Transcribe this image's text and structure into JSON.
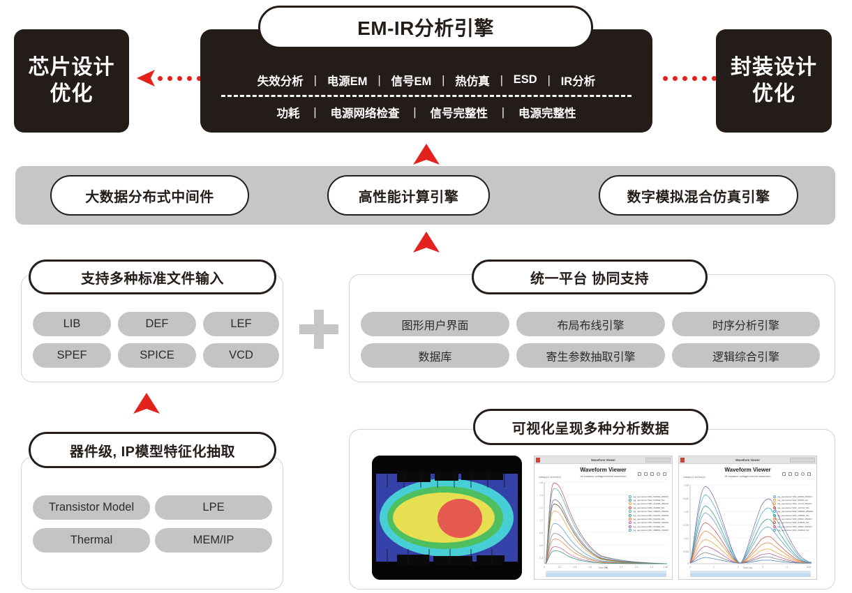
{
  "meta": {
    "colors": {
      "dark": "#231c18",
      "red": "#e3221d",
      "band_gray": "#c6c6c6",
      "tag_gray": "#c4c4c4",
      "card_border": "#d3d3d3",
      "white": "#ffffff"
    }
  },
  "left_outcome": {
    "line1": "芯片设计",
    "line2": "优化"
  },
  "right_outcome": {
    "line1": "封装设计",
    "line2": "优化"
  },
  "engine": {
    "title": "EM-IR分析引擎",
    "row1": [
      "失效分析",
      "电源EM",
      "信号EM",
      "热仿真",
      "ESD",
      "IR分析"
    ],
    "row2": [
      "功耗",
      "电源网络检查",
      "信号完整性",
      "电源完整性"
    ],
    "separator": "|"
  },
  "middleware_band": {
    "items": [
      {
        "label": "大数据分布式中间件"
      },
      {
        "label": "高性能计算引擎"
      },
      {
        "label": "数字模拟混合仿真引擎"
      }
    ]
  },
  "file_input_card": {
    "title": "支持多种标准文件输入",
    "tags": [
      "LIB",
      "DEF",
      "LEF",
      "SPEF",
      "SPICE",
      "VCD"
    ]
  },
  "platform_card": {
    "title": "统一平台 协同支持",
    "tags": [
      "图形用户界面",
      "布局布线引擎",
      "时序分析引擎",
      "数据库",
      "寄生参数抽取引擎",
      "逻辑综合引擎"
    ]
  },
  "model_card": {
    "title": "器件级, IP模型特征化抽取",
    "tags": [
      "Transistor Model",
      "LPE",
      "Thermal",
      "MEM/IP"
    ]
  },
  "visualization_card": {
    "title": "可视化呈现多种分析数据",
    "thermal_thumbnail": {
      "name": "thermal-map-thumbnail",
      "legend_order": [
        "blue",
        "cyan",
        "green",
        "yellow",
        "red"
      ]
    },
    "waveform_viewers": [
      {
        "window_title": "Waveform Viewer",
        "heading": "Waveform Viewer",
        "subheading": "all instance voltage/current waveform",
        "y_axis_label": "voltage(v) /current(A)",
        "x_axis_label": "Time (ns)",
        "y_ticks": [
          "1.6",
          "1.4",
          "1.2",
          "1.0",
          "0.8",
          "0.6",
          "0.4",
          "0.2",
          "0"
        ],
        "x_ticks": [
          "0",
          "0.2",
          "0.4",
          "0.6",
          "0.8",
          "1.0",
          "1.2",
          "1.4",
          "1.60"
        ],
        "legend": [
          "log_reports/csv:VDD_518590_250210",
          "log_reports/csv:VDD_518590_N/1",
          "log_reports/csv:VDD_312590_250210",
          "log_reports/csv:VDD_312590_N/1",
          "log_reports/csv:VDD_308020_250210",
          "log_reports/csv:VDD_521230_250210",
          "log_reports/csv:VDD_501230_N/1",
          "log_reports/csv:VDD_518090_250210",
          "log_reports/csv:VDD_519400_N/1",
          "log_reports/csv:VDD_369800_250210"
        ]
      },
      {
        "window_title": "Waveform Viewer",
        "heading": "Waveform Viewer",
        "subheading": "IR instance voltage/current waveform",
        "y_axis_label": "voltage(v) /current(A)",
        "x_axis_label": "Time (ns)",
        "y_ticks": [
          "0.05",
          "0.025",
          "0.02",
          "0.015",
          "0.01",
          "0.005",
          "0"
        ],
        "x_ticks": [
          "0",
          "1",
          "2",
          "3",
          "4",
          "5.00"
        ],
        "legend": [
          "log_reports/csv:VDD_60530_250210",
          "log_reports/csv:VDD_66590_N/1",
          "log_reports/csv:VDD_10710_250210",
          "log_reports/csv:VDD_101710_N/1",
          "log_reports/csv:VDD_258020_250210",
          "log_reports/csv:VDD_238550_N/1",
          "log_reports/csv:VDD_23602_250210",
          "log_reports/csv:VDD_278020_N/1",
          "log_reports/csv:VDD_32802_250210",
          "log_reports/csv:VDD_219015_N/1"
        ]
      }
    ]
  },
  "plus_separator": {
    "symbol": "+"
  },
  "arrows": {
    "to_left_outcome": "arrow-left-dotted",
    "to_right_outcome": "arrow-right-dotted",
    "band_to_engine": "arrow-up",
    "cards_to_band": "arrow-up",
    "model_to_file_input": "arrow-up"
  },
  "chart_data": [
    {
      "type": "line",
      "title": "Waveform Viewer",
      "subtitle": "all instance voltage/current waveform",
      "xlabel": "Time (ns)",
      "ylabel": "voltage(v) /current(A)",
      "xlim": [
        0,
        1.6
      ],
      "ylim": [
        0,
        1.6
      ],
      "grid": true,
      "legend_position": "right",
      "x": [
        0,
        0.05,
        0.1,
        0.15,
        0.2,
        0.25,
        0.3,
        0.4,
        0.5,
        0.6,
        0.8,
        1.0,
        1.2,
        1.4,
        1.6
      ],
      "series": [
        {
          "name": "VDD_518590_250210",
          "color": "#c0504d",
          "values": [
            0,
            0.7,
            1.35,
            1.5,
            1.5,
            1.45,
            1.3,
            1.0,
            0.72,
            0.5,
            0.25,
            0.13,
            0.07,
            0.04,
            0.02
          ]
        },
        {
          "name": "VDD_518590_N/1",
          "color": "#4bacc6",
          "values": [
            0,
            0.62,
            1.22,
            1.38,
            1.4,
            1.34,
            1.2,
            0.92,
            0.66,
            0.46,
            0.23,
            0.12,
            0.06,
            0.035,
            0.02
          ]
        },
        {
          "name": "VDD_312590_250210",
          "color": "#8064a2",
          "values": [
            0,
            0.52,
            1.0,
            1.13,
            1.15,
            1.1,
            1.0,
            0.76,
            0.55,
            0.38,
            0.19,
            0.1,
            0.05,
            0.03,
            0.015
          ]
        },
        {
          "name": "VDD_312590_N/1",
          "color": "#4f6228",
          "values": [
            0,
            0.48,
            0.93,
            1.06,
            1.08,
            1.03,
            0.94,
            0.71,
            0.51,
            0.36,
            0.18,
            0.09,
            0.05,
            0.03,
            0.015
          ]
        },
        {
          "name": "VDD_308020_250210",
          "color": "#e8a33d",
          "values": [
            0,
            0.42,
            0.82,
            0.93,
            0.95,
            0.91,
            0.83,
            0.63,
            0.45,
            0.31,
            0.16,
            0.08,
            0.04,
            0.025,
            0.012
          ]
        },
        {
          "name": "VDD_521230_250210",
          "color": "#5b9bd5",
          "values": [
            0,
            0.33,
            0.64,
            0.73,
            0.74,
            0.71,
            0.65,
            0.49,
            0.35,
            0.25,
            0.12,
            0.06,
            0.03,
            0.02,
            0.01
          ]
        },
        {
          "name": "VDD_501230_N/1",
          "color": "#7f7f7f",
          "values": [
            0,
            0.23,
            0.45,
            0.51,
            0.52,
            0.5,
            0.45,
            0.34,
            0.25,
            0.17,
            0.09,
            0.045,
            0.025,
            0.015,
            0.008
          ]
        },
        {
          "name": "VDD_518090_250210",
          "color": "#ed7d31",
          "values": [
            0,
            0.19,
            0.37,
            0.42,
            0.43,
            0.41,
            0.37,
            0.28,
            0.2,
            0.14,
            0.07,
            0.035,
            0.02,
            0.012,
            0.006
          ]
        },
        {
          "name": "VDD_519400_N/1",
          "color": "#c55a9a",
          "values": [
            0,
            0.13,
            0.26,
            0.3,
            0.31,
            0.29,
            0.27,
            0.2,
            0.15,
            0.1,
            0.05,
            0.025,
            0.014,
            0.009,
            0.004
          ]
        },
        {
          "name": "VDD_369800_250210",
          "color": "#2e9e7e",
          "values": [
            0,
            0.1,
            0.2,
            0.23,
            0.24,
            0.23,
            0.21,
            0.16,
            0.11,
            0.08,
            0.04,
            0.02,
            0.011,
            0.007,
            0.003
          ]
        }
      ]
    },
    {
      "type": "line",
      "title": "Waveform Viewer",
      "subtitle": "IR instance voltage/current waveform",
      "xlabel": "Time (ns)",
      "ylabel": "voltage(v) /current(A)",
      "xlim": [
        0,
        5
      ],
      "ylim": [
        0,
        0.05
      ],
      "grid": true,
      "legend_position": "right",
      "x": [
        0,
        0.3,
        0.6,
        0.9,
        1.2,
        1.6,
        2.0,
        2.4,
        2.7,
        3.0,
        3.4,
        3.8,
        4.2,
        4.6,
        5.0
      ],
      "series": [
        {
          "name": "VDD_60530_250210",
          "color": "#8064a2",
          "values": [
            0.001,
            0.03,
            0.048,
            0.042,
            0.03,
            0.016,
            0.004,
            0.012,
            0.03,
            0.035,
            0.028,
            0.018,
            0.011,
            0.007,
            0.006
          ]
        },
        {
          "name": "VDD_66590_N/1",
          "color": "#4bacc6",
          "values": [
            0.001,
            0.024,
            0.038,
            0.033,
            0.024,
            0.013,
            0.003,
            0.01,
            0.024,
            0.028,
            0.022,
            0.014,
            0.009,
            0.006,
            0.005
          ]
        },
        {
          "name": "VDD_10710_250210",
          "color": "#2e9e7e",
          "values": [
            0.001,
            0.018,
            0.028,
            0.025,
            0.018,
            0.01,
            0.002,
            0.008,
            0.018,
            0.021,
            0.017,
            0.011,
            0.007,
            0.005,
            0.004
          ]
        },
        {
          "name": "VDD_101710_N/1",
          "color": "#5b9bd5",
          "values": [
            0.001,
            0.015,
            0.024,
            0.021,
            0.015,
            0.008,
            0.002,
            0.006,
            0.014,
            0.017,
            0.013,
            0.009,
            0.006,
            0.004,
            0.003
          ]
        },
        {
          "name": "VDD_258020_250210",
          "color": "#c0504d",
          "values": [
            0.001,
            0.011,
            0.017,
            0.015,
            0.011,
            0.006,
            0.0015,
            0.005,
            0.01,
            0.012,
            0.01,
            0.007,
            0.004,
            0.003,
            0.003
          ]
        },
        {
          "name": "VDD_238550_N/1",
          "color": "#ed7d31",
          "values": [
            0.001,
            0.008,
            0.013,
            0.012,
            0.009,
            0.005,
            0.001,
            0.004,
            0.008,
            0.009,
            0.008,
            0.005,
            0.003,
            0.002,
            0.002
          ]
        },
        {
          "name": "VDD_23602_250210",
          "color": "#e8a33d",
          "values": [
            0.001,
            0.006,
            0.009,
            0.008,
            0.006,
            0.003,
            0.001,
            0.003,
            0.006,
            0.007,
            0.006,
            0.004,
            0.003,
            0.002,
            0.002
          ]
        },
        {
          "name": "VDD_278020_N/1",
          "color": "#c55a9a",
          "values": [
            0.001,
            0.004,
            0.007,
            0.006,
            0.005,
            0.003,
            0.001,
            0.002,
            0.004,
            0.005,
            0.004,
            0.003,
            0.002,
            0.002,
            0.001
          ]
        },
        {
          "name": "VDD_32802_250210",
          "color": "#7f7f7f",
          "values": [
            0.001,
            0.003,
            0.005,
            0.004,
            0.003,
            0.002,
            0.001,
            0.002,
            0.003,
            0.004,
            0.003,
            0.002,
            0.002,
            0.001,
            0.001
          ]
        },
        {
          "name": "VDD_219015_N/1",
          "color": "#4f81bd",
          "values": [
            0.0005,
            0.002,
            0.003,
            0.003,
            0.002,
            0.0015,
            0.0008,
            0.001,
            0.002,
            0.0025,
            0.002,
            0.0015,
            0.001,
            0.001,
            0.001
          ]
        }
      ]
    }
  ]
}
